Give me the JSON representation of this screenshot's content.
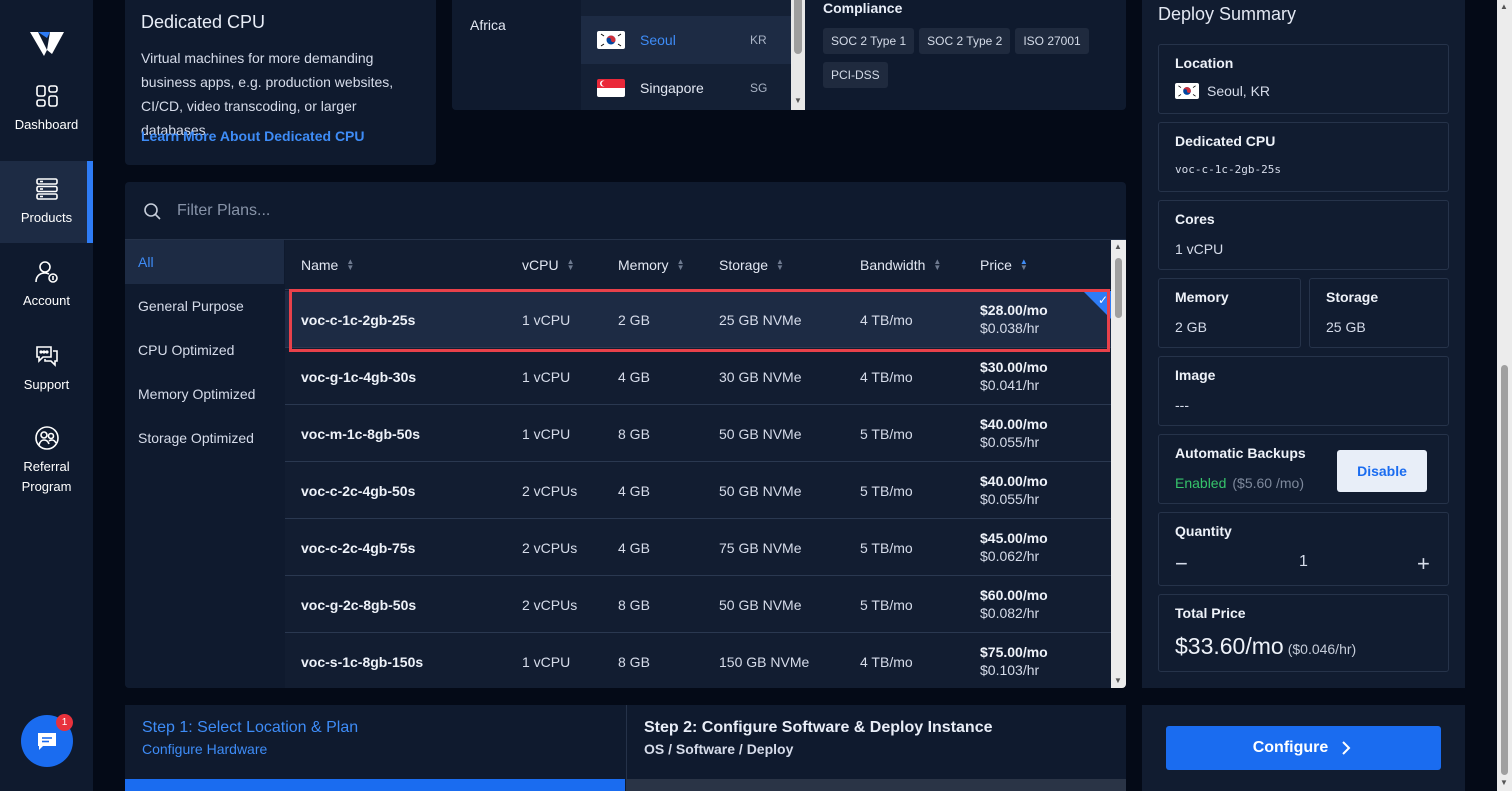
{
  "nav": {
    "items": [
      {
        "label": "Dashboard"
      },
      {
        "label": "Products"
      },
      {
        "label": "Account"
      },
      {
        "label": "Support"
      },
      {
        "label": "Referral Program"
      }
    ],
    "chat_badge": "1"
  },
  "dedicated": {
    "title": "Dedicated CPU",
    "description": "Virtual machines for more demanding business apps, e.g. production websites, CI/CD, video transcoding, or larger databases.",
    "link": "Learn More About Dedicated CPU"
  },
  "location": {
    "region": "Africa",
    "cities": [
      {
        "name": "Seoul",
        "code": "KR"
      },
      {
        "name": "Singapore",
        "code": "SG"
      }
    ],
    "compliance_title": "Compliance",
    "badges": [
      "SOC 2 Type 1",
      "SOC 2 Type 2",
      "ISO 27001",
      "PCI-DSS"
    ]
  },
  "plans": {
    "filter_placeholder": "Filter Plans...",
    "categories": [
      "All",
      "General Purpose",
      "CPU Optimized",
      "Memory Optimized",
      "Storage Optimized"
    ],
    "columns": [
      "Name",
      "vCPU",
      "Memory",
      "Storage",
      "Bandwidth",
      "Price"
    ],
    "rows": [
      {
        "name": "voc-c-1c-2gb-25s",
        "vcpu": "1 vCPU",
        "memory": "2 GB",
        "storage": "25 GB NVMe",
        "bandwidth": "4 TB/mo",
        "mo": "$28.00/mo",
        "hr": "$0.038/hr"
      },
      {
        "name": "voc-g-1c-4gb-30s",
        "vcpu": "1 vCPU",
        "memory": "4 GB",
        "storage": "30 GB NVMe",
        "bandwidth": "4 TB/mo",
        "mo": "$30.00/mo",
        "hr": "$0.041/hr"
      },
      {
        "name": "voc-m-1c-8gb-50s",
        "vcpu": "1 vCPU",
        "memory": "8 GB",
        "storage": "50 GB NVMe",
        "bandwidth": "5 TB/mo",
        "mo": "$40.00/mo",
        "hr": "$0.055/hr"
      },
      {
        "name": "voc-c-2c-4gb-50s",
        "vcpu": "2 vCPUs",
        "memory": "4 GB",
        "storage": "50 GB NVMe",
        "bandwidth": "5 TB/mo",
        "mo": "$40.00/mo",
        "hr": "$0.055/hr"
      },
      {
        "name": "voc-c-2c-4gb-75s",
        "vcpu": "2 vCPUs",
        "memory": "4 GB",
        "storage": "75 GB NVMe",
        "bandwidth": "5 TB/mo",
        "mo": "$45.00/mo",
        "hr": "$0.062/hr"
      },
      {
        "name": "voc-g-2c-8gb-50s",
        "vcpu": "2 vCPUs",
        "memory": "8 GB",
        "storage": "50 GB NVMe",
        "bandwidth": "5 TB/mo",
        "mo": "$60.00/mo",
        "hr": "$0.082/hr"
      },
      {
        "name": "voc-s-1c-8gb-150s",
        "vcpu": "1 vCPU",
        "memory": "8 GB",
        "storage": "150 GB NVMe",
        "bandwidth": "4 TB/mo",
        "mo": "$75.00/mo",
        "hr": "$0.103/hr"
      }
    ]
  },
  "steps": {
    "step1_title": "Step 1: Select Location & Plan",
    "step1_sub": "Configure Hardware",
    "step2_title": "Step 2: Configure Software & Deploy Instance",
    "step2_sub": "OS / Software / Deploy"
  },
  "summary": {
    "title": "Deploy Summary",
    "location_label": "Location",
    "location_value": "Seoul, KR",
    "plan_label": "Dedicated CPU",
    "plan_value": "voc-c-1c-2gb-25s",
    "cores_label": "Cores",
    "cores_value": "1 vCPU",
    "memory_label": "Memory",
    "memory_value": "2 GB",
    "storage_label": "Storage",
    "storage_value": "25 GB",
    "image_label": "Image",
    "image_value": "---",
    "backups_label": "Automatic Backups",
    "backups_status": "Enabled",
    "backups_fee": "($5.60 /mo)",
    "disable_label": "Disable",
    "quantity_label": "Quantity",
    "quantity_minus": "−",
    "quantity_value": "1",
    "quantity_plus": "+",
    "total_label": "Total Price",
    "total_mo": "$33.60/mo",
    "total_hr": "($0.046/hr)",
    "configure_label": "Configure"
  },
  "colors": {
    "accent": "#1a6cf0",
    "highlight": "#e8414a",
    "enabled": "#36c46b"
  }
}
